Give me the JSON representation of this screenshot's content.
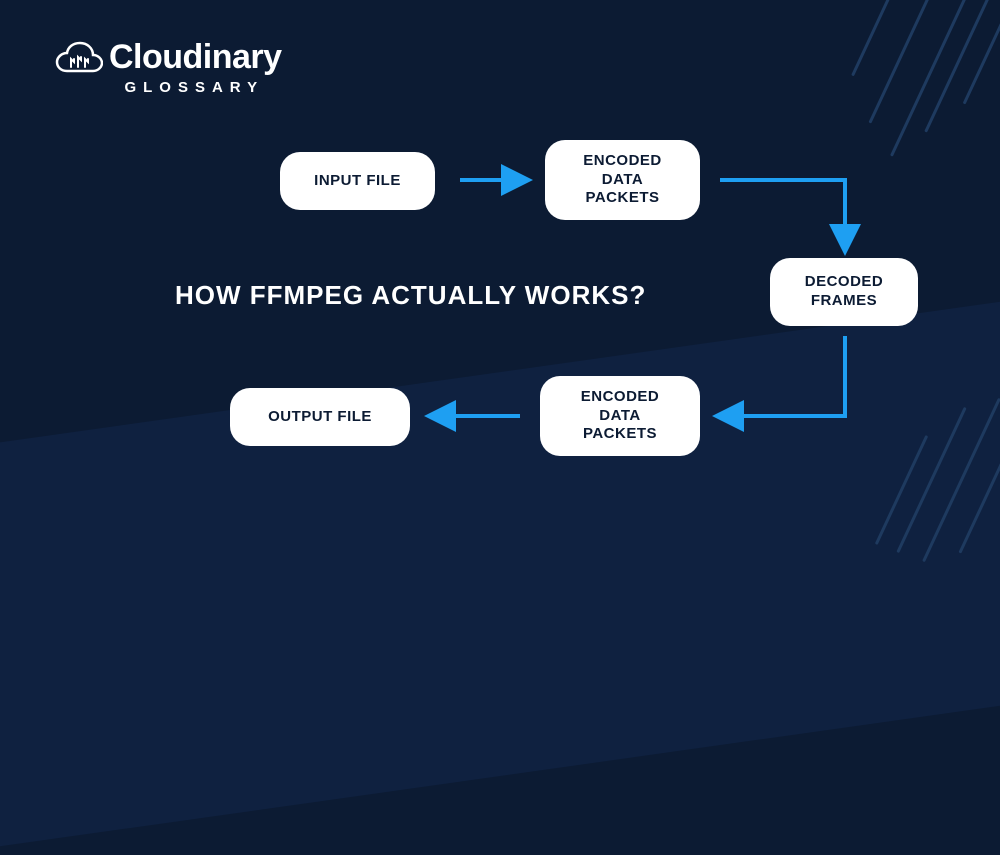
{
  "logo": {
    "brand": "Cloudinary",
    "sub": "GLOSSARY"
  },
  "title": "HOW FFMPEG ACTUALLY WORKS?",
  "nodes": {
    "input": "INPUT FILE",
    "encodedIn": "ENCODED\nDATA\nPACKETS",
    "decoded": "DECODED\nFRAMES",
    "encodedOut": "ENCODED\nDATA\nPACKETS",
    "output": "OUTPUT FILE"
  },
  "colors": {
    "arrow": "#1E9FF2"
  }
}
